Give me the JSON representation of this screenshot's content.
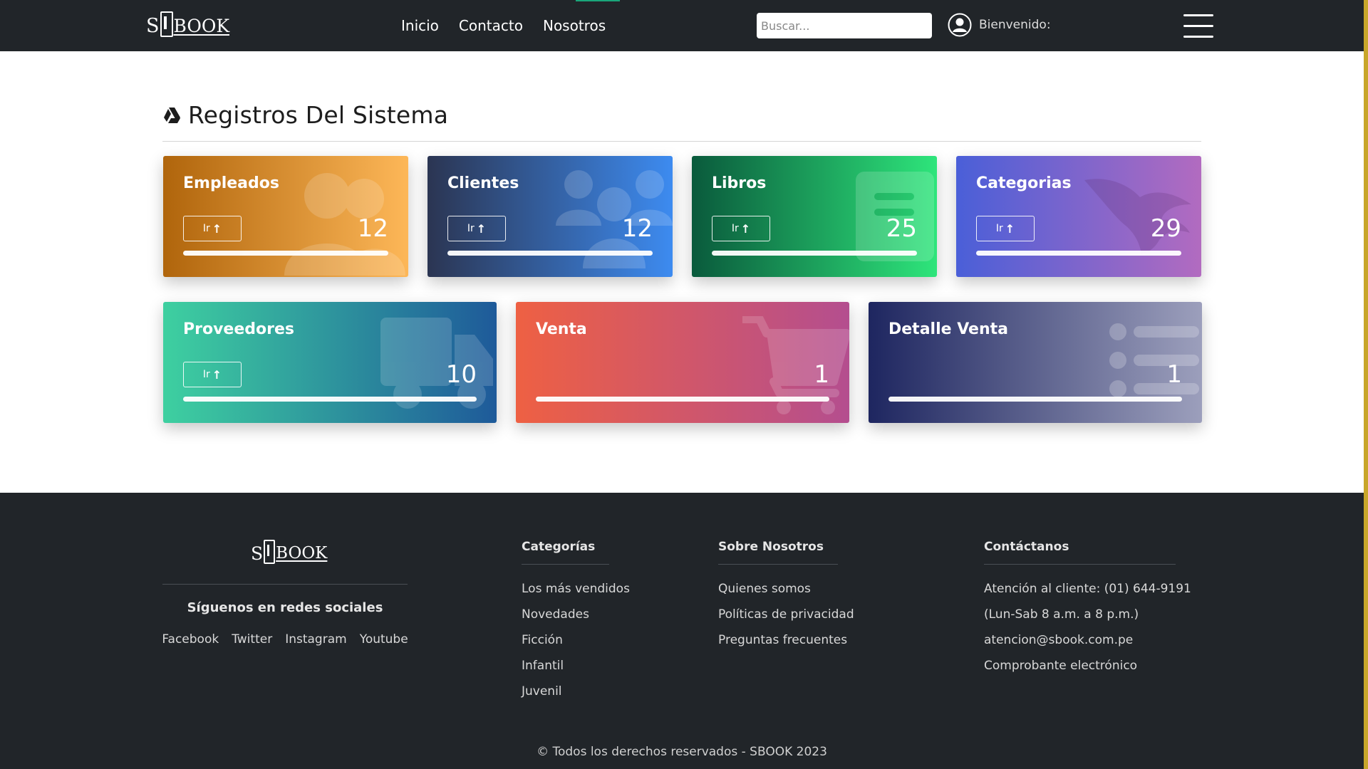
{
  "nav": {
    "brand": {
      "prefix": "S",
      "text": "BOOK"
    },
    "links": [
      "Inicio",
      "Contacto",
      "Nosotros"
    ],
    "search_placeholder": "Buscar...",
    "welcome": "Bienvenido:"
  },
  "section": {
    "title": "Registros Del Sistema"
  },
  "cards": [
    {
      "title": "Empleados",
      "button": "Ir",
      "count": "12",
      "icon": "users-icon",
      "gradient": [
        "#b0650c",
        "#fdb758"
      ]
    },
    {
      "title": "Clientes",
      "button": "Ir",
      "count": "12",
      "icon": "group-icon",
      "gradient": [
        "#2b3552",
        "#3d8bf0"
      ]
    },
    {
      "title": "Libros",
      "button": "Ir",
      "count": "25",
      "icon": "book-icon",
      "gradient": [
        "#0a5a3c",
        "#2ee57b"
      ]
    },
    {
      "title": "Categorias",
      "button": "Ir",
      "count": "29",
      "icon": "phoenix-icon",
      "gradient": [
        "#4a5fd8",
        "#b26bc0"
      ]
    },
    {
      "title": "Proveedores",
      "button": "Ir",
      "count": "10",
      "icon": "truck-icon",
      "gradient": [
        "#3ed0a0",
        "#1e5a9a"
      ]
    },
    {
      "title": "Venta",
      "count": "1",
      "icon": "cart-icon",
      "gradient": [
        "#ee6043",
        "#b44e8f"
      ]
    },
    {
      "title": "Detalle Venta",
      "count": "1",
      "icon": "list-icon",
      "gradient": [
        "#1e2660",
        "#9c9fbc"
      ]
    }
  ],
  "footer": {
    "brand": {
      "prefix": "S",
      "text": "BOOK"
    },
    "social_title": "Síguenos en redes sociales",
    "social_links": [
      "Facebook",
      "Twitter",
      "Instagram",
      "Youtube"
    ],
    "columns": [
      {
        "title": "Categorías",
        "items": [
          "Los más vendidos",
          "Novedades",
          "Ficción",
          "Infantil",
          "Juvenil"
        ]
      },
      {
        "title": "Sobre Nosotros",
        "items": [
          "Quienes somos",
          "Políticas de privacidad",
          "Preguntas frecuentes"
        ]
      },
      {
        "title": "Contáctanos",
        "items": [
          "Atención al cliente: (01) 644-9191",
          "(Lun-Sab 8 a.m. a 8 p.m.)",
          "atencion@sbook.com.pe",
          "Comprobante electrónico"
        ]
      }
    ],
    "copyright": "© Todos los derechos reservados - SBOOK 2023"
  }
}
